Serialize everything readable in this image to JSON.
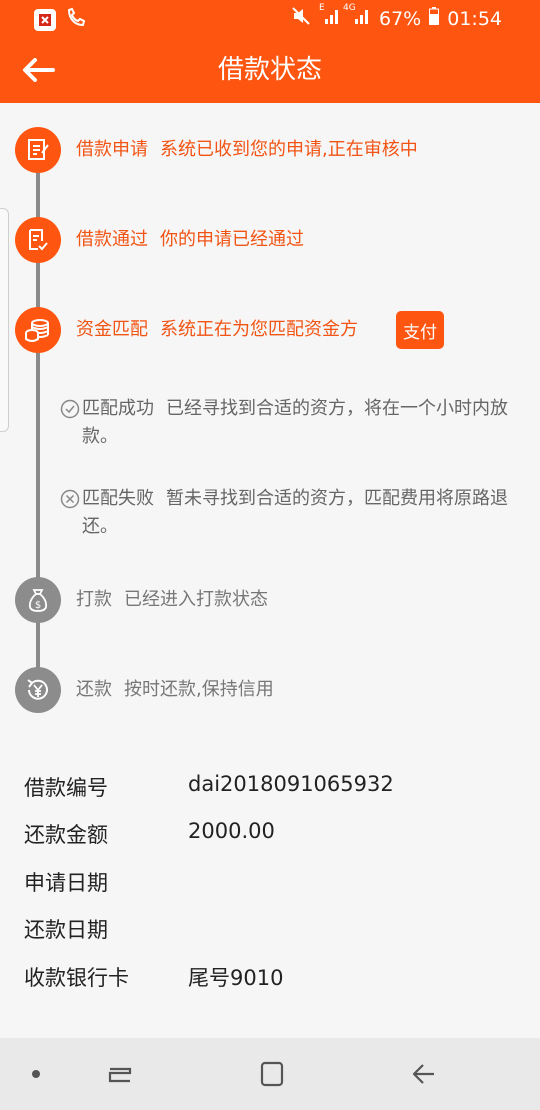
{
  "status_bar": {
    "battery": "67%",
    "time": "01:54",
    "net_small": "E",
    "net_4g": "4G"
  },
  "header": {
    "title": "借款状态",
    "back_icon": "arrow-left-icon"
  },
  "timeline": {
    "steps": [
      {
        "title": "借款申请",
        "desc": "系统已收到您的申请,正在审核中",
        "state": "active",
        "icon": "edit-document-icon"
      },
      {
        "title": "借款通过",
        "desc": "你的申请已经通过",
        "state": "active",
        "icon": "document-check-icon"
      },
      {
        "title": "资金匹配",
        "desc": "系统正在为您匹配资金方",
        "state": "active",
        "icon": "coins-icon",
        "button": "支付"
      },
      {
        "title": "打款",
        "desc": "已经进入打款状态",
        "state": "inactive",
        "icon": "money-bag-icon"
      },
      {
        "title": "还款",
        "desc": "按时还款,保持信用",
        "state": "inactive",
        "icon": "repay-yen-icon"
      }
    ],
    "match_results": [
      {
        "title": "匹配成功",
        "desc": "已经寻找到合适的资方，将在一个小时内放款。",
        "icon": "check-circle-icon"
      },
      {
        "title": "匹配失败",
        "desc": "暂未寻找到合适的资方，匹配费用将原路退还。",
        "icon": "x-circle-icon"
      }
    ]
  },
  "loan_info": [
    {
      "label": "借款编号",
      "value": "dai2018091065932"
    },
    {
      "label": "还款金额",
      "value": "2000.00"
    },
    {
      "label": "申请日期",
      "value": ""
    },
    {
      "label": "还款日期",
      "value": ""
    },
    {
      "label": "收款银行卡",
      "value": "尾号9010"
    }
  ],
  "colors": {
    "accent": "#fe5510",
    "inactive": "#8c8c8c"
  }
}
